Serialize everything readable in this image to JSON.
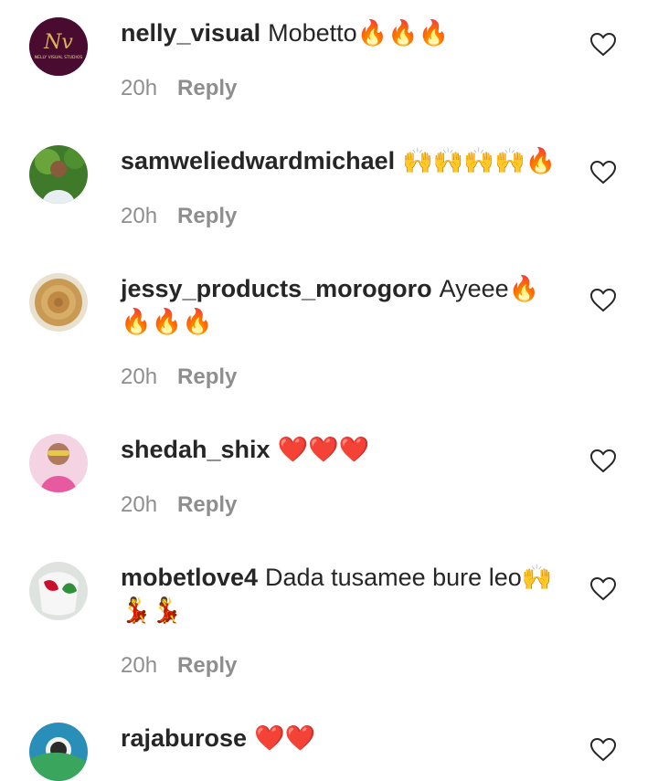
{
  "comments": [
    {
      "username": "nelly_visual",
      "text": "Mobetto🔥🔥🔥",
      "time": "20h",
      "reply": "Reply",
      "avatar_text": "Nv",
      "avatar_caption": "NELLY VISUAL STUDIOS"
    },
    {
      "username": "samweliedwardmichael",
      "text": "🙌🙌🙌🙌🔥",
      "time": "20h",
      "reply": "Reply"
    },
    {
      "username": "jessy_products_morogoro",
      "text": "Ayeee🔥🔥🔥🔥",
      "time": "20h",
      "reply": "Reply"
    },
    {
      "username": "shedah_shix",
      "text": "❤️❤️❤️",
      "time": "20h",
      "reply": "Reply"
    },
    {
      "username": "mobetlove4",
      "text": "Dada tusamee bure leo🙌💃💃",
      "time": "20h",
      "reply": "Reply"
    },
    {
      "username": "rajaburose",
      "text": "❤️❤️",
      "time": "",
      "reply": ""
    }
  ],
  "colors": {
    "username": "#262626",
    "meta": "#8e8e8e",
    "heart_stroke": "#262626"
  }
}
